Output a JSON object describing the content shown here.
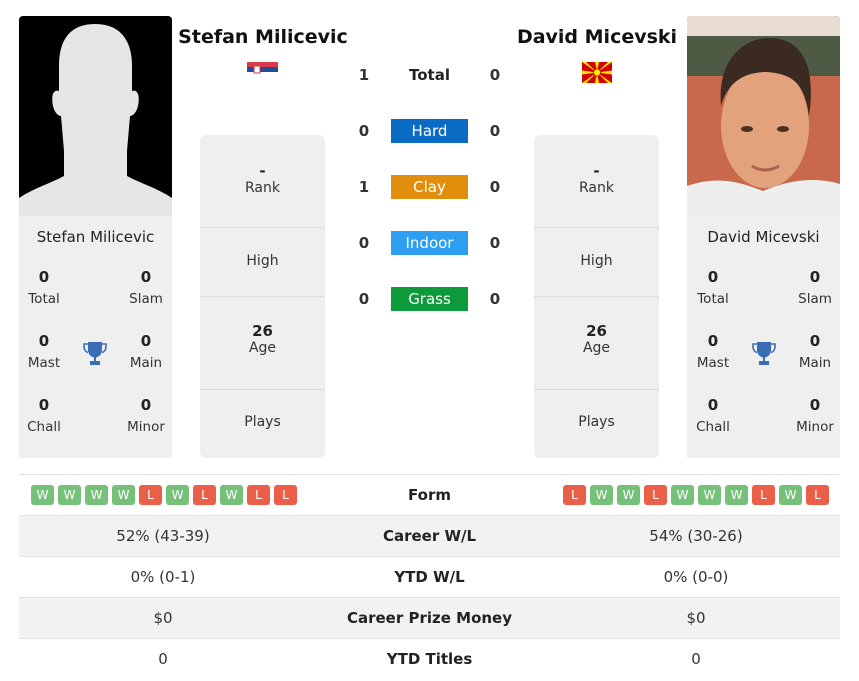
{
  "players": {
    "left": {
      "name": "Stefan Milicevic",
      "flag": "serbia-flag",
      "photo": "silhouette-placeholder",
      "titles": {
        "total": {
          "value": "0",
          "label": "Total"
        },
        "slam": {
          "value": "0",
          "label": "Slam"
        },
        "mast": {
          "value": "0",
          "label": "Mast"
        },
        "main": {
          "value": "0",
          "label": "Main"
        },
        "chall": {
          "value": "0",
          "label": "Chall"
        },
        "minor": {
          "value": "0",
          "label": "Minor"
        }
      },
      "info": {
        "rank": {
          "value": "-",
          "label": "Rank"
        },
        "high": {
          "value": "",
          "label": "High"
        },
        "age": {
          "value": "26",
          "label": "Age"
        },
        "plays": {
          "value": "",
          "label": "Plays"
        }
      }
    },
    "right": {
      "name": "David Micevski",
      "flag": "north-macedonia-flag",
      "photo": "player-photo",
      "titles": {
        "total": {
          "value": "0",
          "label": "Total"
        },
        "slam": {
          "value": "0",
          "label": "Slam"
        },
        "mast": {
          "value": "0",
          "label": "Mast"
        },
        "main": {
          "value": "0",
          "label": "Main"
        },
        "chall": {
          "value": "0",
          "label": "Chall"
        },
        "minor": {
          "value": "0",
          "label": "Minor"
        }
      },
      "info": {
        "rank": {
          "value": "-",
          "label": "Rank"
        },
        "high": {
          "value": "",
          "label": "High"
        },
        "age": {
          "value": "26",
          "label": "Age"
        },
        "plays": {
          "value": "",
          "label": "Plays"
        }
      }
    }
  },
  "h2h": {
    "total": {
      "label": "Total",
      "left": "1",
      "right": "0"
    },
    "surfaces": [
      {
        "label": "Hard",
        "left": "0",
        "right": "0",
        "color": "#0a6bc4"
      },
      {
        "label": "Clay",
        "left": "1",
        "right": "0",
        "color": "#e08e0b"
      },
      {
        "label": "Indoor",
        "left": "0",
        "right": "0",
        "color": "#2d9ef2"
      },
      {
        "label": "Grass",
        "left": "0",
        "right": "0",
        "color": "#0d9a3b"
      }
    ]
  },
  "comparison": {
    "form": {
      "label": "Form",
      "left": [
        "W",
        "W",
        "W",
        "W",
        "L",
        "W",
        "L",
        "W",
        "L",
        "L"
      ],
      "right": [
        "L",
        "W",
        "W",
        "L",
        "W",
        "W",
        "W",
        "L",
        "W",
        "L"
      ]
    },
    "rows": [
      {
        "label": "Career W/L",
        "left": "52% (43-39)",
        "right": "54% (30-26)"
      },
      {
        "label": "YTD W/L",
        "left": "0% (0-1)",
        "right": "0% (0-0)"
      },
      {
        "label": "Career Prize Money",
        "left": "$0",
        "right": "$0"
      },
      {
        "label": "YTD Titles",
        "left": "0",
        "right": "0"
      }
    ]
  },
  "colors": {
    "win": "#77c07a",
    "loss": "#ea5f47",
    "trophy": "#3a6db5"
  }
}
